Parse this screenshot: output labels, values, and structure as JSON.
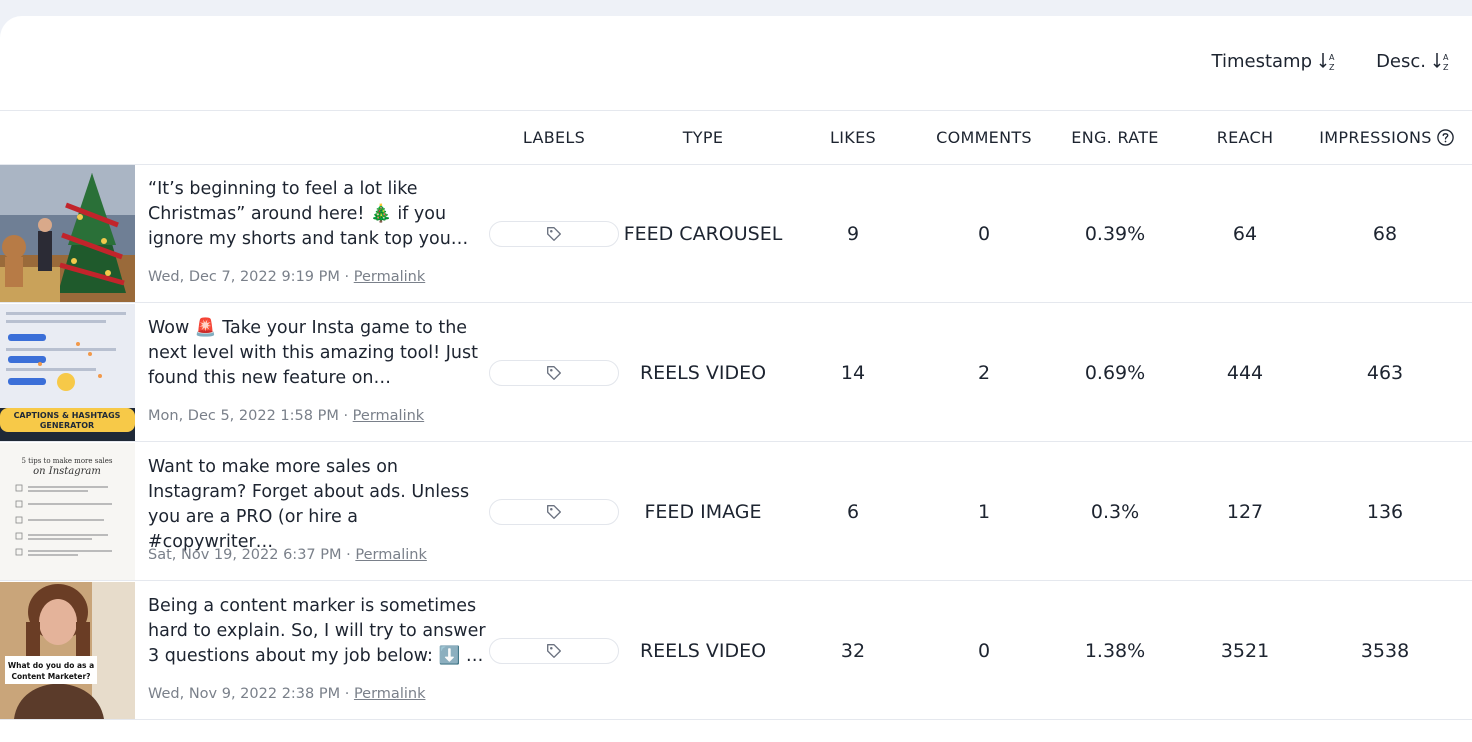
{
  "sort": {
    "timestamp_label": "Timestamp",
    "direction_label": "Desc."
  },
  "columns": {
    "labels": "LABELS",
    "type": "TYPE",
    "likes": "LIKES",
    "comments": "COMMENTS",
    "eng_rate": "ENG. RATE",
    "reach": "REACH",
    "impressions": "IMPRESSIONS"
  },
  "rows": [
    {
      "caption": "“It’s beginning to feel a lot like Christmas” around here! 🎄 if you ignore my shorts and tank top you…",
      "date": "Wed, Dec 7, 2022 9:19 PM",
      "separator": " · ",
      "permalink": "Permalink",
      "type": "FEED CAROUSEL",
      "likes": "9",
      "comments": "0",
      "eng_rate": "0.39%",
      "reach": "64",
      "impressions": "68"
    },
    {
      "caption": "Wow 🚨 Take your Insta game to the next level with this amazing tool! Just found this new feature on…",
      "date": "Mon, Dec 5, 2022 1:58 PM",
      "separator": " · ",
      "permalink": "Permalink",
      "type": "REELS VIDEO",
      "likes": "14",
      "comments": "2",
      "eng_rate": "0.69%",
      "reach": "444",
      "impressions": "463",
      "thumb_text_1": "CAPTIONS & HASHTAGS",
      "thumb_text_2": "GENERATOR"
    },
    {
      "caption": "Want to make more sales on Instagram? Forget about ads. Unless you are a PRO (or hire a #copywriter…",
      "date": "Sat, Nov 19, 2022 6:37 PM",
      "separator": " · ",
      "permalink": "Permalink",
      "type": "FEED IMAGE",
      "likes": "6",
      "comments": "1",
      "eng_rate": "0.3%",
      "reach": "127",
      "impressions": "136",
      "thumb_title_1": "5 tips to make more sales",
      "thumb_title_2": "on Instagram"
    },
    {
      "caption": "Being a content marker is sometimes hard to explain. So, I will try to answer 3 questions about my job below: ⬇️ …",
      "date": "Wed, Nov 9, 2022 2:38 PM",
      "separator": " · ",
      "permalink": "Permalink",
      "type": "REELS VIDEO",
      "likes": "32",
      "comments": "0",
      "eng_rate": "1.38%",
      "reach": "3521",
      "impressions": "3538",
      "thumb_text_1": "What do you do as a",
      "thumb_text_2": "Content Marketer?"
    }
  ],
  "icons": {
    "sort": "sort-az-icon",
    "tag": "tag-icon",
    "help": "question-circle-icon"
  },
  "colors": {
    "text": "#1d2430",
    "muted": "#7a808a",
    "divider": "#e5e8ee",
    "page_bg": "#eef1f7"
  }
}
